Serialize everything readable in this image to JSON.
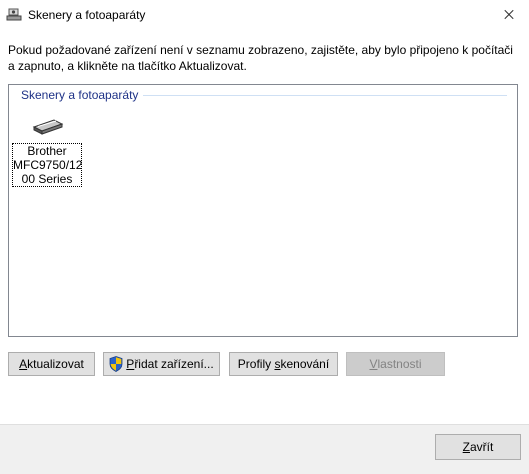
{
  "window": {
    "title": "Skenery a fotoaparáty"
  },
  "instructions": "Pokud požadované zařízení není v seznamu zobrazeno, zajistěte, aby bylo připojeno k počítači a zapnuto, a klikněte na tlačítko Aktualizovat.",
  "group": {
    "header": "Skenery a fotoaparáty"
  },
  "devices": [
    {
      "label": "Brother MFC9750/1200 Series",
      "line1": "Brother",
      "line2": "MFC9750/12",
      "line3": "00 Series"
    }
  ],
  "buttons": {
    "refresh": {
      "pre": "",
      "u": "A",
      "post": "ktualizovat"
    },
    "add": {
      "pre": "",
      "u": "P",
      "post": "řidat zařízení..."
    },
    "profiles": {
      "pre": "Profily ",
      "u": "s",
      "post": "kenování"
    },
    "properties": {
      "pre": "",
      "u": "V",
      "post": "lastnosti"
    },
    "close": {
      "pre": "",
      "u": "Z",
      "post": "avřít"
    }
  },
  "colors": {
    "group_header": "#1e3287",
    "button_face": "#e1e1e1",
    "footer": "#f0f0f0"
  }
}
